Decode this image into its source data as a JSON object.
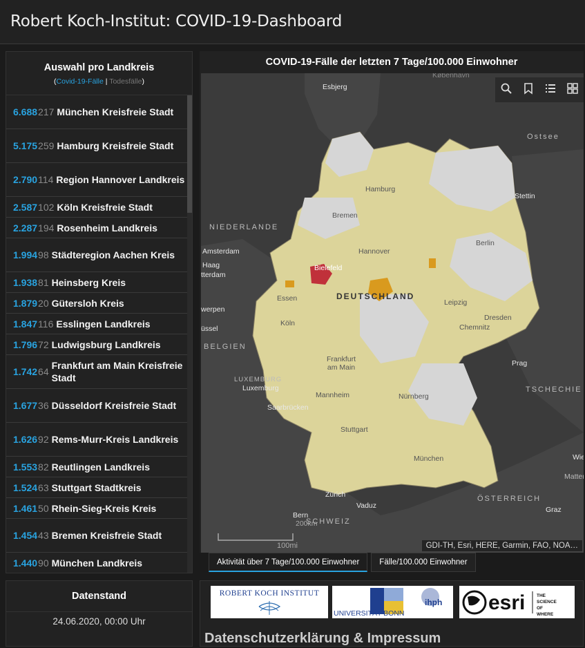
{
  "header": {
    "title": "Robert Koch-Institut: COVID-19-Dashboard"
  },
  "list": {
    "title": "Auswahl pro Landkreis",
    "sub_open": "(",
    "sub_active": "Covid-19-Fälle",
    "sub_sep": " | ",
    "sub_inactive": "Todesfälle",
    "sub_close": ")",
    "rows": [
      {
        "cases": "6.688",
        "deaths": "217",
        "name": "München Kreisfreie Stadt"
      },
      {
        "cases": "5.175",
        "deaths": "259",
        "name": "Hamburg Kreisfreie Stadt"
      },
      {
        "cases": "2.790",
        "deaths": "114",
        "name": "Region Hannover Landkreis"
      },
      {
        "cases": "2.587",
        "deaths": "102",
        "name": "Köln Kreisfreie Stadt"
      },
      {
        "cases": "2.287",
        "deaths": "194",
        "name": "Rosenheim Landkreis"
      },
      {
        "cases": "1.994",
        "deaths": "98",
        "name": "Städteregion Aachen Kreis"
      },
      {
        "cases": "1.938",
        "deaths": "81",
        "name": "Heinsberg Kreis"
      },
      {
        "cases": "1.879",
        "deaths": "20",
        "name": "Gütersloh Kreis"
      },
      {
        "cases": "1.847",
        "deaths": "116",
        "name": "Esslingen Landkreis"
      },
      {
        "cases": "1.796",
        "deaths": "72",
        "name": "Ludwigsburg Landkreis"
      },
      {
        "cases": "1.742",
        "deaths": "64",
        "name": "Frankfurt am Main Kreisfreie Stadt"
      },
      {
        "cases": "1.677",
        "deaths": "36",
        "name": "Düsseldorf Kreisfreie Stadt"
      },
      {
        "cases": "1.626",
        "deaths": "92",
        "name": "Rems-Murr-Kreis Landkreis"
      },
      {
        "cases": "1.553",
        "deaths": "82",
        "name": "Reutlingen Landkreis"
      },
      {
        "cases": "1.524",
        "deaths": "63",
        "name": "Stuttgart Stadtkreis"
      },
      {
        "cases": "1.461",
        "deaths": "50",
        "name": "Rhein-Sieg-Kreis Kreis"
      },
      {
        "cases": "1.454",
        "deaths": "43",
        "name": "Bremen Kreisfreie Stadt"
      },
      {
        "cases": "1.440",
        "deaths": "90",
        "name": "München Landkreis"
      }
    ]
  },
  "datenstand": {
    "title": "Datenstand",
    "value": "24.06.2020, 00:00 Uhr"
  },
  "map": {
    "title": "COVID-19-Fälle der letzten 7 Tage/100.000 Einwohner",
    "attribution": "GDI-TH, Esri, HERE, Garmin, FAO, NOA…",
    "scale": "100mi",
    "labels": {
      "esbjerg": "Esbjerg",
      "kopenhagen": "København",
      "ostsee": "Ostsee",
      "hamburg": "Hamburg",
      "stettin": "Stettin",
      "bremen": "Bremen",
      "niederlande": "NIEDERLANDE",
      "amsterdam": "Amsterdam",
      "haag": "Haag",
      "rotterdam": "tterdam",
      "hannover": "Hannover",
      "berlin": "Berlin",
      "bielefeld": "Bielefeld",
      "deutschland": "DEUTSCHLAND",
      "essen": "Essen",
      "leipzig": "Leipzig",
      "antwerpen": "werpen",
      "dresden": "Dresden",
      "koeln": "Köln",
      "bruessel": "üssel",
      "chemnitz": "Chemnitz",
      "belgien": "BELGIEN",
      "frankfurt": "Frankfurt am Main",
      "prag": "Prag",
      "luxemburg_c": "LUXEMBURG",
      "luxemburg": "Luxemburg",
      "tschechien": "TSCHECHIE",
      "mannheim": "Mannheim",
      "nuernberg": "Nürnberg",
      "saarbruecken": "Saarbrücken",
      "stuttgart": "Stuttgart",
      "muenchen": "München",
      "wien": "Wie",
      "matter": "Matter",
      "oesterreich": "ÖSTERREICH",
      "zuerich": "Zürich",
      "vaduz": "Vaduz",
      "graz": "Graz",
      "bern": "Bern",
      "schweiz": "SCHWEIZ",
      "km": "200km"
    }
  },
  "tabs": [
    {
      "label": "Aktivität über 7 Tage/100.000 Einwohner"
    },
    {
      "label": "Fälle/100.000 Einwohner"
    }
  ],
  "logos": {
    "rki": "ROBERT KOCH INSTITUT",
    "bonn": "UNIVERSITÄT BONN",
    "ihph": "ihph",
    "esri": "esri",
    "esri_tag": "THE SCIENCE OF WHERE"
  },
  "footer": {
    "impressum": "Datenschutzerklärung & Impressum"
  },
  "colors": {
    "accent": "#29a3e0",
    "hotspot": "#c0313a",
    "medium": "#d99a1e",
    "low": "#dcd49a",
    "zero": "#d6d6d6"
  }
}
